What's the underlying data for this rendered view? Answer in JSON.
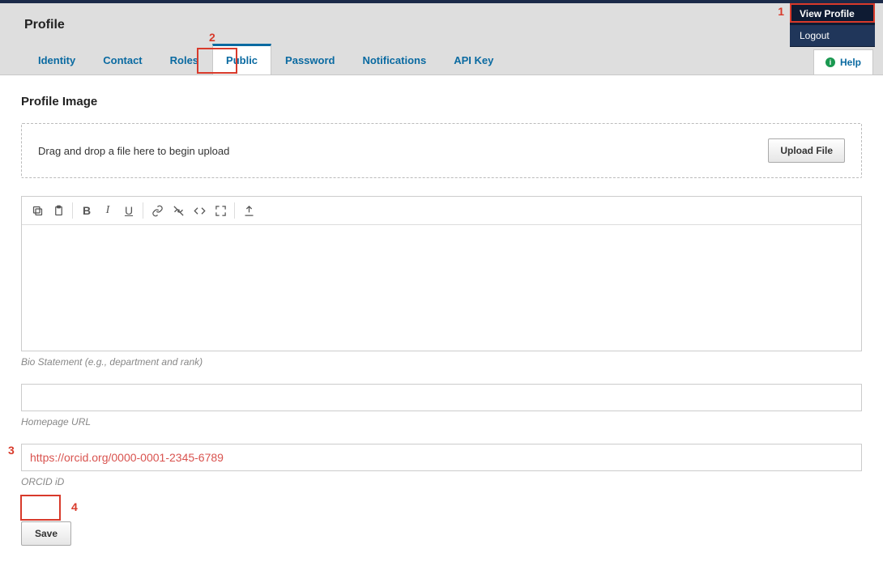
{
  "user_menu": {
    "view_profile": "View Profile",
    "logout": "Logout"
  },
  "header": {
    "title": "Profile",
    "help_label": "Help"
  },
  "tabs": {
    "identity": "Identity",
    "contact": "Contact",
    "roles": "Roles",
    "public": "Public",
    "password": "Password",
    "notifications": "Notifications",
    "api_key": "API Key"
  },
  "profile_image": {
    "heading": "Profile Image",
    "drop_text": "Drag and drop a file here to begin upload",
    "upload_label": "Upload File"
  },
  "bio": {
    "value": "",
    "label": "Bio Statement (e.g., department and rank)"
  },
  "homepage": {
    "value": "",
    "label": "Homepage URL"
  },
  "orcid": {
    "value": "https://orcid.org/0000-0001-2345-6789",
    "label": "ORCID iD"
  },
  "save_label": "Save",
  "annotations": {
    "n1": "1",
    "n2": "2",
    "n3": "3",
    "n4": "4"
  }
}
